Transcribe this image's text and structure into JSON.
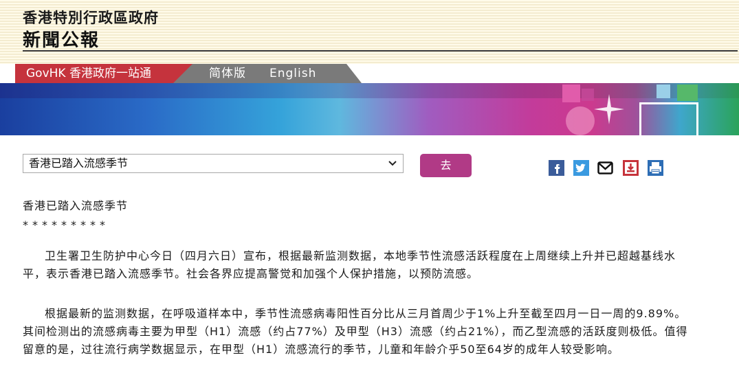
{
  "header": {
    "government_name": "香港特別行政區政府",
    "publication_name": "新聞公報"
  },
  "nav": {
    "govhk_label": "GovHK 香港政府一站通",
    "simplified_label": "简体版",
    "english_label": "English"
  },
  "controls": {
    "topic_selected": "香港已踏入流感季节",
    "go_label": "去"
  },
  "share_icons": [
    "facebook-icon",
    "twitter-icon",
    "email-icon",
    "download-icon",
    "print-icon"
  ],
  "colors": {
    "govhk_red": "#c5333d",
    "nav_gray": "#7a7a7a",
    "go_button": "#b13a86"
  },
  "article": {
    "title": "香港已踏入流感季节",
    "stars": "*********",
    "paragraphs": [
      "卫生署卫生防护中心今日（四月六日）宣布，根据最新监测数据，本地季节性流感活跃程度在上周继续上升并已超越基线水平，表示香港已踏入流感季节。社会各界应提高警觉和加强个人保护措施，以预防流感。",
      "根据最新的监测数据，在呼吸道样本中，季节性流感病毒阳性百分比从三月首周少于1%上升至截至四月一日一周的9.89%。其间检测出的流感病毒主要为甲型（H1）流感（约占77%）及甲型（H3）流感（约占21%），而乙型流感的活跃度则极低。值得留意的是，过往流行病学数据显示，在甲型（H1）流感流行的季节，儿童和年龄介乎50至64岁的成年人较受影响。"
    ]
  }
}
